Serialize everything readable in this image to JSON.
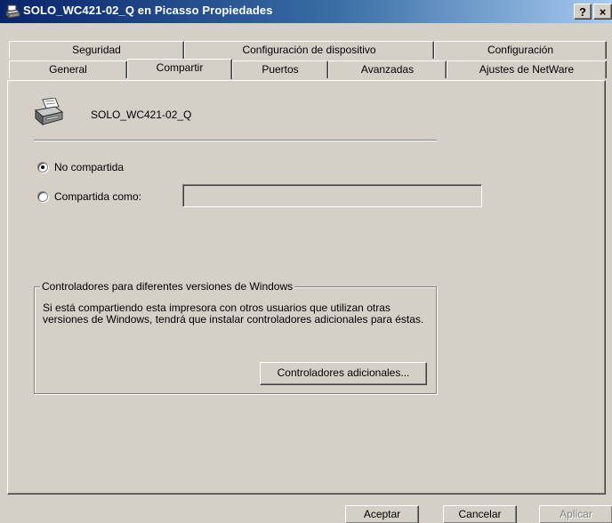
{
  "window": {
    "title": "SOLO_WC421-02_Q en Picasso Propiedades",
    "help_label": "?",
    "close_label": "×"
  },
  "tabs": {
    "row1": [
      "Seguridad",
      "Configuración de dispositivo",
      "Configuración"
    ],
    "row2": [
      "General",
      "Compartir",
      "Puertos",
      "Avanzadas",
      "Ajustes de NetWare"
    ],
    "active": "Compartir"
  },
  "printer": {
    "name": "SOLO_WC421-02_Q",
    "icon": "printer-icon"
  },
  "sharing": {
    "not_shared_label": "No compartida",
    "shared_as_label": "Compartida como:",
    "share_name_value": "",
    "selected": "not_shared"
  },
  "drivers": {
    "group_title": "Controladores para diferentes versiones de Windows",
    "description": "Si está compartiendo esta impresora con otros usuarios que utilizan otras versiones de Windows, tendrá que instalar controladores adicionales para éstas.",
    "additional_button": "Controladores adicionales..."
  },
  "footer": {
    "ok_label": "Aceptar",
    "cancel_label": "Cancelar",
    "apply_label": "Aplicar"
  },
  "colors": {
    "face": "#d4d0c8",
    "title_start": "#0a246a",
    "title_end": "#a6caf0"
  }
}
